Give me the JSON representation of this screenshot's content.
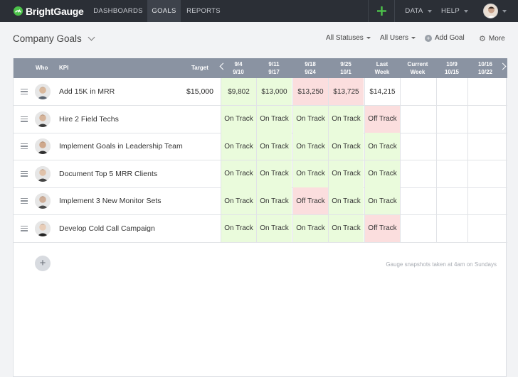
{
  "nav": {
    "brand": "BrightGauge",
    "items": [
      "DASHBOARDS",
      "GOALS",
      "REPORTS"
    ],
    "plus": "+",
    "data": "DATA",
    "help": "HELP"
  },
  "page": {
    "title": "Company Goals",
    "filters": {
      "statuses": "All Statuses",
      "users": "All Users",
      "add_goal": "Add Goal",
      "more": "More"
    }
  },
  "table": {
    "headers": {
      "who": "Who",
      "kpi": "KPI",
      "target": "Target",
      "weeks": [
        [
          "9/4",
          "9/10"
        ],
        [
          "9/11",
          "9/17"
        ],
        [
          "9/18",
          "9/24"
        ],
        [
          "9/25",
          "10/1"
        ],
        [
          "Last",
          "Week"
        ],
        [
          "Current",
          "Week"
        ],
        [
          "10/9",
          "10/15"
        ],
        [
          "10/16",
          "10/22"
        ]
      ]
    },
    "rows": [
      {
        "kpi": "Add 15K in MRR",
        "target": "$15,000",
        "cells": [
          "$9,802",
          "$13,000",
          "$13,250",
          "$13,725",
          "$14,215",
          "",
          "",
          ""
        ],
        "status": [
          "green",
          "green",
          "red",
          "red",
          "",
          "",
          "",
          ""
        ]
      },
      {
        "kpi": "Hire 2 Field Techs",
        "target": "",
        "cells": [
          "On Track",
          "On Track",
          "On Track",
          "On Track",
          "Off Track",
          "",
          "",
          ""
        ],
        "status": [
          "green",
          "green",
          "green",
          "green",
          "red",
          "",
          "",
          ""
        ]
      },
      {
        "kpi": "Implement Goals in Leadership Team",
        "target": "",
        "cells": [
          "On Track",
          "On Track",
          "On Track",
          "On Track",
          "On Track",
          "",
          "",
          ""
        ],
        "status": [
          "green",
          "green",
          "green",
          "green",
          "green",
          "",
          "",
          ""
        ]
      },
      {
        "kpi": "Document Top 5 MRR Clients",
        "target": "",
        "cells": [
          "On Track",
          "On Track",
          "On Track",
          "On Track",
          "On Track",
          "",
          "",
          ""
        ],
        "status": [
          "green",
          "green",
          "green",
          "green",
          "green",
          "",
          "",
          ""
        ]
      },
      {
        "kpi": "Implement 3 New Monitor Sets",
        "target": "",
        "cells": [
          "On Track",
          "On Track",
          "Off Track",
          "On Track",
          "On Track",
          "",
          "",
          ""
        ],
        "status": [
          "green",
          "green",
          "red",
          "green",
          "green",
          "",
          "",
          ""
        ]
      },
      {
        "kpi": "Develop Cold Call Campaign",
        "target": "",
        "cells": [
          "On Track",
          "On Track",
          "On Track",
          "On Track",
          "Off Track",
          "",
          "",
          ""
        ],
        "status": [
          "green",
          "green",
          "green",
          "green",
          "red",
          "",
          "",
          ""
        ]
      }
    ]
  },
  "footer": {
    "add_button": "+",
    "note": "Gauge snapshots taken at 4am on Sundays"
  },
  "colors": {
    "nav_bg": "#2b2f36",
    "header_bg": "#8a93a2",
    "on_track": "#eafbdc",
    "off_track": "#fbdede",
    "brand_green": "#4cc24a"
  }
}
